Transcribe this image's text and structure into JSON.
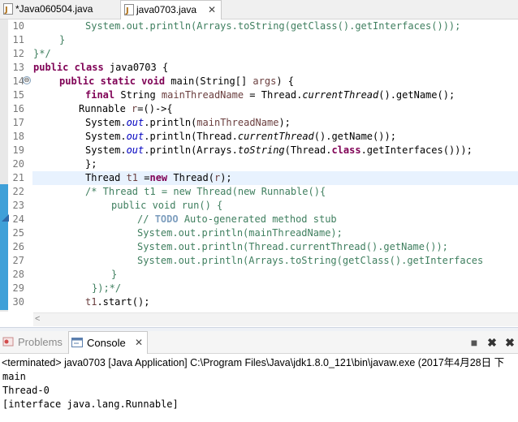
{
  "editor_tabs": [
    {
      "label": "*Java060504.java",
      "active": false
    },
    {
      "label": "java0703.java",
      "active": true,
      "close": "✕"
    }
  ],
  "line_numbers": [
    "10",
    "11",
    "12",
    "13",
    "14",
    "15",
    "16",
    "17",
    "18",
    "19",
    "20",
    "21",
    "22",
    "23",
    "24",
    "25",
    "26",
    "27",
    "28",
    "29",
    "30"
  ],
  "code": {
    "l10": "System.out.println(Arrays.toString(getClass().getInterfaces()));",
    "l11": "}",
    "l12": "}*/",
    "l13a": "public class",
    "l13b": " java0703 {",
    "l14a": "public static void",
    "l14b": " main(String[] ",
    "l14c": "args",
    "l14d": ") {",
    "l15a": "final",
    "l15b": " String ",
    "l15c": "mainThreadName",
    "l15d": " = Thread.",
    "l15e": "currentThread",
    "l15f": "().getName();",
    "l16a": "Runnable ",
    "l16b": "r",
    "l16c": "=()->{",
    "l17a": "System.",
    "l17b": "out",
    "l17c": ".println(",
    "l17d": "mainThreadName",
    "l17e": ");",
    "l18a": "System.",
    "l18b": "out",
    "l18c": ".println(Thread.",
    "l18d": "currentThread",
    "l18e": "().getName());",
    "l19a": "System.",
    "l19b": "out",
    "l19c": ".println(Arrays.",
    "l19d": "toString",
    "l19e": "(Thread.",
    "l19f": "class",
    "l19g": ".getInterfaces()));",
    "l20": "};",
    "l21a": "Thread ",
    "l21b": "t1",
    "l21c": " =",
    "l21d": "new",
    "l21e": " Thread(",
    "l21f": "r",
    "l21g": ");",
    "l22": "/* Thread t1 = new Thread(new Runnable(){",
    "l23": "public void run() {",
    "l24a": "// ",
    "l24b": "TODO",
    "l24c": " Auto-generated method stub",
    "l25": "System.out.println(mainThreadName);",
    "l26": "System.out.println(Thread.currentThread().getName());",
    "l27": "System.out.println(Arrays.toString(getClass().getInterfaces",
    "l28": "}",
    "l29": "});*/",
    "l30a": "t1",
    "l30b": ".start();"
  },
  "fold_marker": "⊖",
  "console_tabs": [
    {
      "label": "Problems",
      "active": false
    },
    {
      "label": "Console",
      "active": true,
      "close": "✕"
    }
  ],
  "console": {
    "terminated": "<terminated> java0703 [Java Application] C:\\Program Files\\Java\\jdk1.8.0_121\\bin\\javaw.exe (2017年4月28日 下",
    "output": [
      "main",
      "Thread-0",
      "[interface java.lang.Runnable]"
    ]
  },
  "colors": {
    "keyword": "#7f0055",
    "field": "#0000c0",
    "comment": "#3f7f5f",
    "current_line": "#e8f2fe",
    "change_bar": "#3fa0d8"
  },
  "icons": [
    "java-file-icon",
    "close-icon",
    "problems-icon",
    "console-icon",
    "terminate-icon",
    "remove-launch-icon",
    "remove-all-icon"
  ]
}
